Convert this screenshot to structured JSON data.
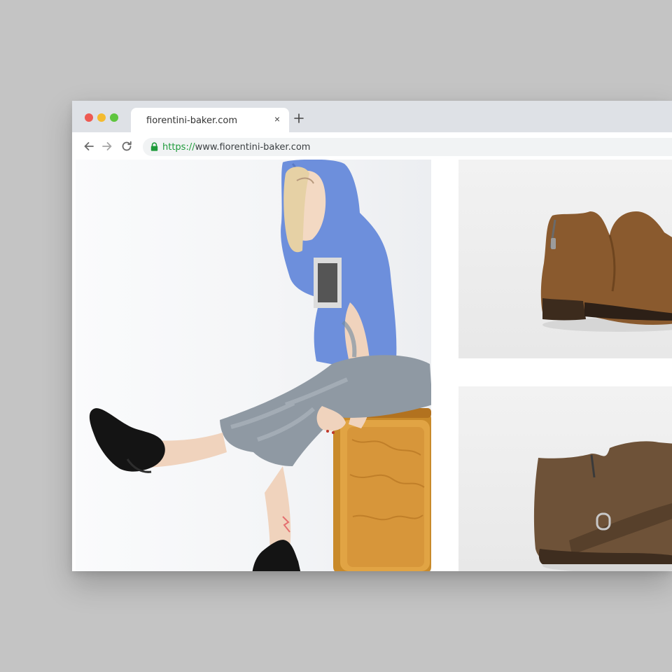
{
  "browser": {
    "tab_title": "fiorentini-baker.com",
    "tab_close": "×",
    "url_scheme": "https://",
    "url_rest": "www.fiorentini-baker.com"
  },
  "icons": [
    "close-icon",
    "plus-icon",
    "arrow-left-icon",
    "arrow-right-icon",
    "reload-icon",
    "lock-icon"
  ],
  "colors": {
    "traffic_red": "#ee5a52",
    "traffic_yellow": "#f4bb2f",
    "traffic_green": "#5fc53f",
    "https_green": "#1e9a3a",
    "hoodie_blue": "#6d8fdc",
    "boot_tan": "#8a5a2e",
    "boot_suede": "#6e5238"
  },
  "gallery": {
    "hero": "model-photo",
    "thumbnails": [
      "brown-leather-ankle-boot",
      "brown-suede-buckle-boot"
    ]
  }
}
